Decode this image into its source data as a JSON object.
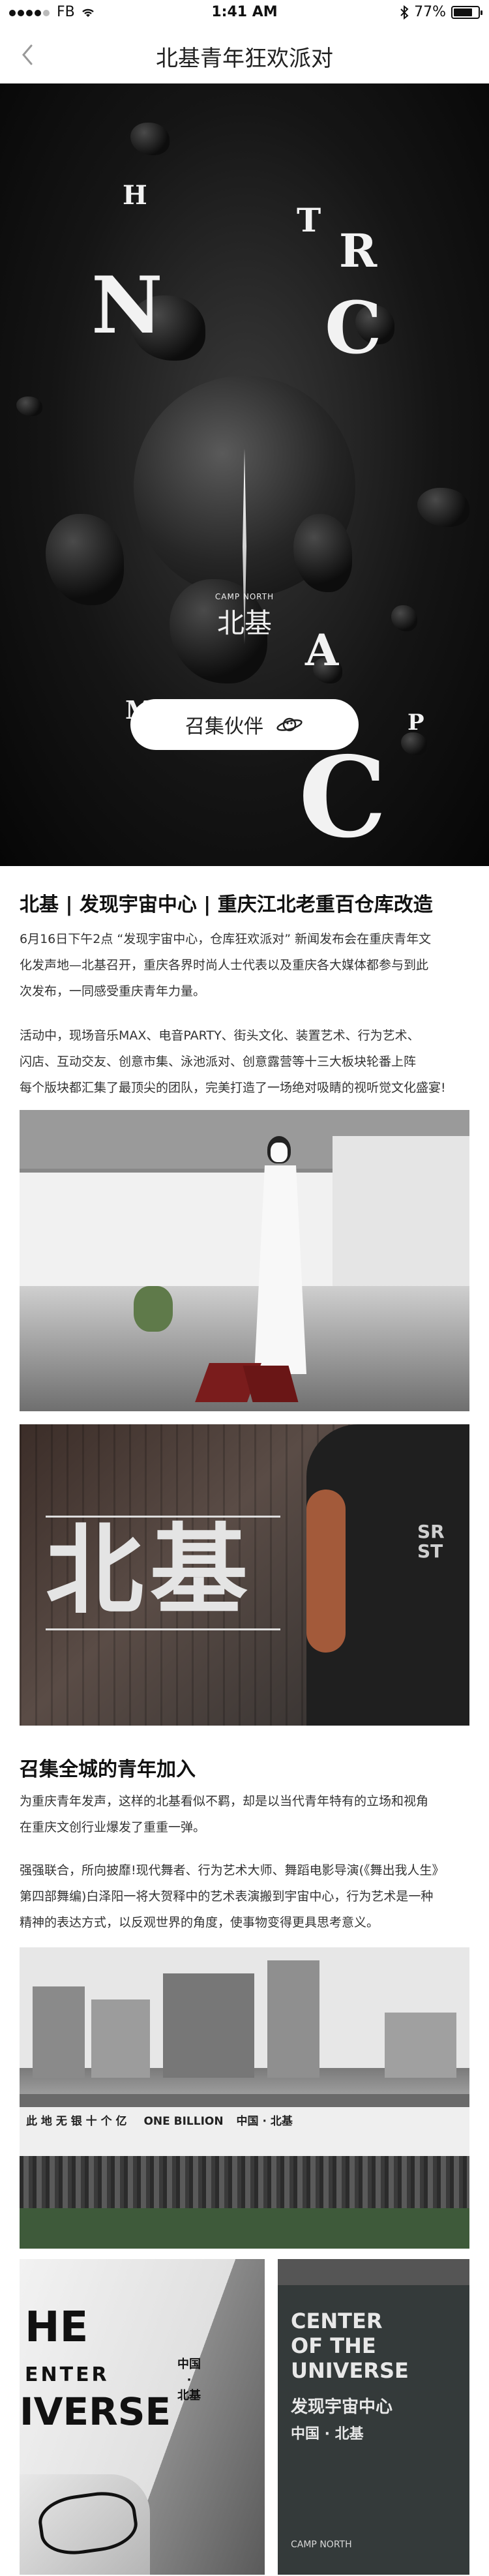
{
  "status": {
    "carrier": "FB",
    "time": "1:41 AM",
    "battery": "77%",
    "battery_level": 0.77
  },
  "nav": {
    "title": "北基青年狂欢派对"
  },
  "hero": {
    "letters": [
      "H",
      "T",
      "R",
      "N",
      "C",
      "A",
      "M",
      "P",
      "C"
    ],
    "logo_small": "CAMP NORTH",
    "logo_big": "北基",
    "recruit_button": "召集伙伴"
  },
  "article": {
    "heading": "北基 | 发现宇宙中心 | 重庆江北老重百仓库改造",
    "para1_lines": [
      "6月16日下午2点 “发现宇宙中心，仓库狂欢派对” 新闻发布会在重庆青年文",
      "化发声地—北基召开，重庆各界时尚人士代表以及重庆各大媒体都参与到此",
      "次发布，一同感受重庆青年力量。"
    ],
    "para2_lines": [
      "活动中，现场音乐MAX、电音PARTY、街头文化、装置艺术、行为艺术、",
      "闪店、互动交友、创意市集、泳池派对、创意露营等十三大板块轮番上阵",
      "每个版块都汇集了最顶尖的团队，完美打造了一场绝对吸睛的视听觉文化盛宴!"
    ],
    "photo2_sign": "北基",
    "photo2_shirt": "SR ST",
    "heading2": "召集全城的青年加入",
    "para3_lines": [
      "为重庆青年发声，这样的北基看似不羁，却是以当代青年特有的立场和视角",
      "在重庆文创行业爆发了重重一弹。"
    ],
    "para4_lines": [
      "强强联合，所向披靡!现代舞者、行为艺术大师、舞蹈电影导演(《舞出我人生》",
      "第四部舞编)白泽阳一将大贺释中的艺术表演搬到宇宙中心，行为艺术是一种",
      "精神的表达方式，以反观世界的角度，使事物变得更具思考意义。"
    ],
    "warehouse_sign_cn": "此 地 无 银 十 个 亿",
    "warehouse_sign_en": "ONE BILLION",
    "warehouse_sign_cn2": "中国 · 北基",
    "wall_letters": [
      "HE",
      "ENTER",
      "IVERSE"
    ],
    "wall_side": [
      "中国",
      "·",
      "北基"
    ],
    "sign_lines": [
      "CENTER",
      "OF THE",
      "UNIVERSE"
    ],
    "sign_cn": "发现宇宙中心",
    "sign_cn2": "中国 · 北基",
    "sign_small": "CAMP NORTH"
  }
}
